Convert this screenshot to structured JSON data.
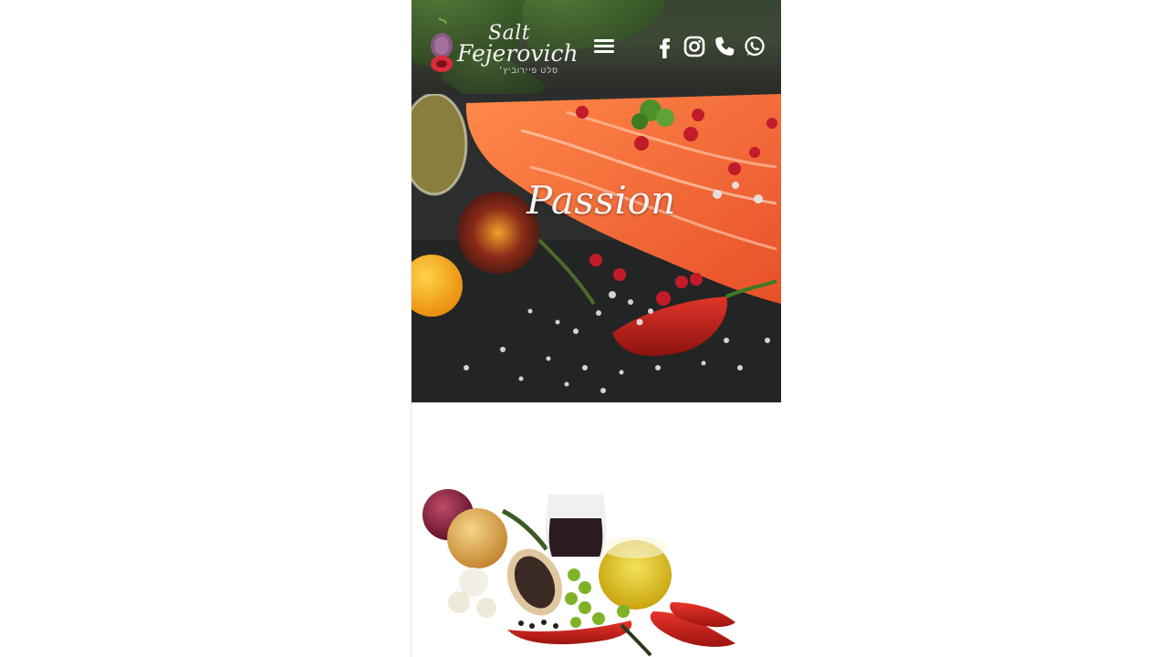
{
  "header": {
    "logo": {
      "word1": "Salt",
      "word2": "Fejerovich",
      "sub": "סלט פיירוביץ׳"
    },
    "menu_icon": "hamburger-icon",
    "social": [
      {
        "name": "facebook-icon"
      },
      {
        "name": "instagram-icon"
      },
      {
        "name": "phone-icon"
      },
      {
        "name": "whatsapp-icon"
      }
    ]
  },
  "hero": {
    "title": "Passion"
  },
  "colors": {
    "header_dark": "#3b3b35",
    "salmon": "#f26b3a",
    "pepper_red": "#c8231c",
    "slate": "#2a2c2b"
  }
}
